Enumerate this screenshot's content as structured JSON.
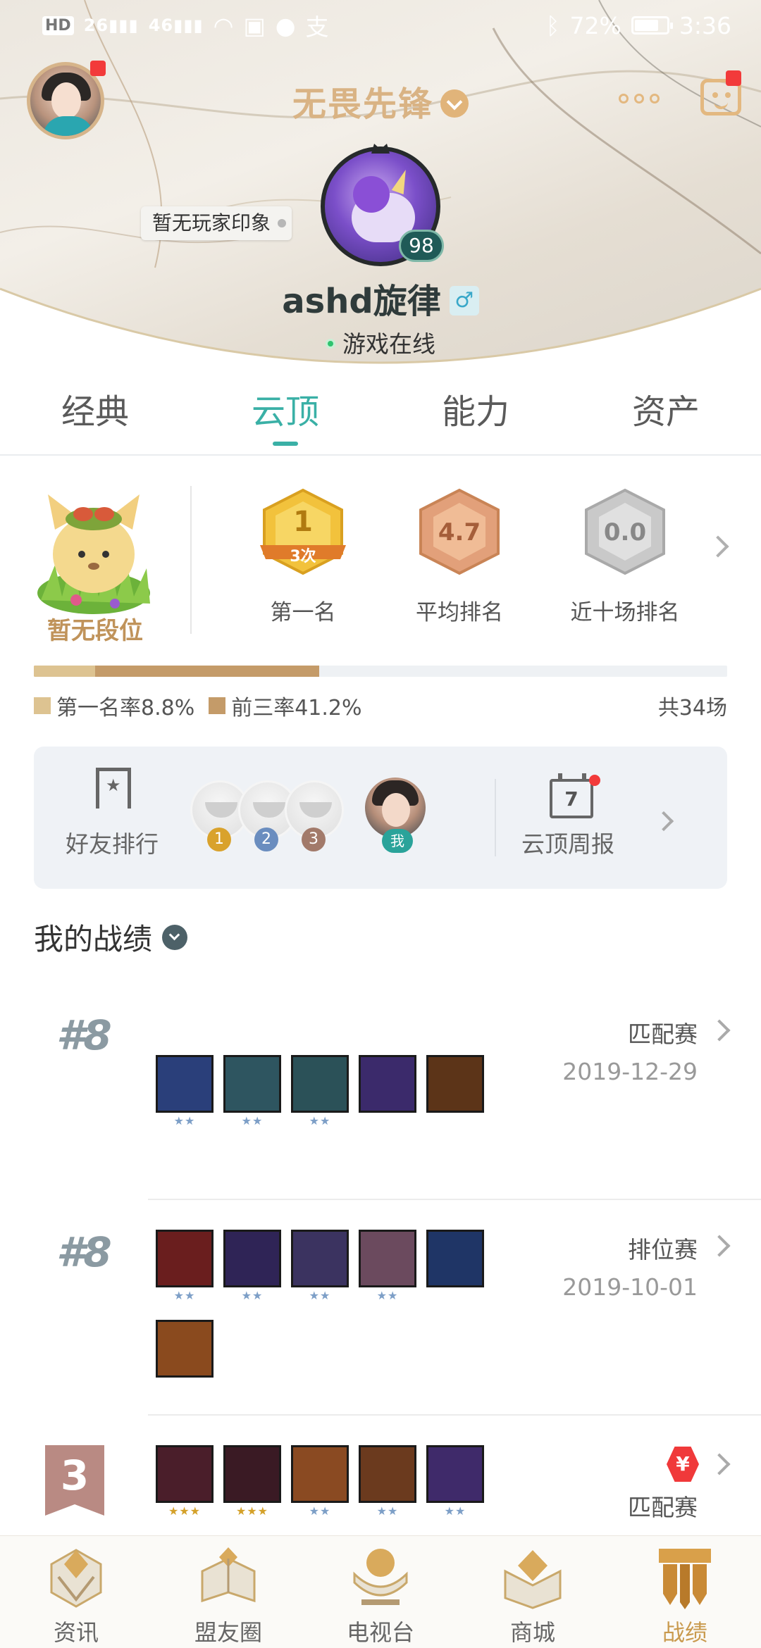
{
  "status_bar": {
    "left_chip": "HD",
    "left_chip_sub": "2",
    "signal_1": "26",
    "signal_2": "46",
    "battery_percent": "72%",
    "time": "3:36"
  },
  "header": {
    "title": "无畏先锋",
    "impression_tag": "暂无玩家印象",
    "level": "98",
    "player_name": "ashd旋律",
    "gender_symbol": "♂",
    "online_status": "游戏在线"
  },
  "tabs": [
    {
      "label": "经典",
      "active": false
    },
    {
      "label": "云顶",
      "active": true
    },
    {
      "label": "能力",
      "active": false
    },
    {
      "label": "资产",
      "active": false
    }
  ],
  "rank": {
    "no_rank_label": "暂无段位",
    "stats": [
      {
        "medal_value": "1",
        "medal_sub": "3次",
        "label": "第一名",
        "color": "#f2c23c"
      },
      {
        "medal_value": "4.7",
        "medal_sub": "",
        "label": "平均排名",
        "color": "#e2a07a"
      },
      {
        "medal_value": "0.0",
        "medal_sub": "",
        "label": "近十场排名",
        "color": "#c9c9c9"
      }
    ],
    "first_rate": 0.088,
    "top3_rate": 0.412,
    "first_rate_label": "第一名率8.8%",
    "top3_rate_label": "前三率41.2%",
    "total_games_label": "共34场"
  },
  "friend_card": {
    "friend_rank_label": "好友排行",
    "rank_numbers": [
      "1",
      "2",
      "3"
    ],
    "me_label": "我",
    "calendar_number": "7",
    "weekly_label": "云顶周报"
  },
  "records": {
    "title": "我的战绩",
    "matches": [
      {
        "placement": "#8",
        "mode": "匹配赛",
        "date": "2019-12-29",
        "champions": [
          {
            "icon": "champion-1",
            "color": "#2a3f7a",
            "stars": "★★",
            "star_color": "blue"
          },
          {
            "icon": "champion-2",
            "color": "#2e5560",
            "stars": "★★",
            "star_color": "blue"
          },
          {
            "icon": "champion-3",
            "color": "#2b5158",
            "stars": "★★",
            "star_color": "blue"
          },
          {
            "icon": "champion-4",
            "color": "#3b2a6b",
            "stars": "",
            "star_color": "blue"
          },
          {
            "icon": "champion-5",
            "color": "#5c3418",
            "stars": "",
            "star_color": "blue"
          }
        ]
      },
      {
        "placement": "#8",
        "mode": "排位赛",
        "date": "2019-10-01",
        "champions": [
          {
            "icon": "champion-6",
            "color": "#6a1e1e",
            "stars": "★★",
            "star_color": "blue"
          },
          {
            "icon": "champion-7",
            "color": "#2f2456",
            "stars": "★★",
            "star_color": "blue"
          },
          {
            "icon": "champion-8",
            "color": "#3b3360",
            "stars": "★★",
            "star_color": "blue"
          },
          {
            "icon": "champion-9",
            "color": "#6b4a5e",
            "stars": "★★",
            "star_color": "blue"
          },
          {
            "icon": "champion-10",
            "color": "#1f3566",
            "stars": "",
            "star_color": "blue"
          },
          {
            "icon": "champion-11",
            "color": "#8a4a1e",
            "stars": "",
            "star_color": "blue"
          }
        ]
      },
      {
        "placement": "3",
        "mode": "匹配赛",
        "currency_badge": "¥",
        "champions": [
          {
            "icon": "champion-12",
            "color": "#4a1e2a",
            "stars": "★★★",
            "star_color": "gold"
          },
          {
            "icon": "champion-13",
            "color": "#3a1a24",
            "stars": "★★★",
            "star_color": "gold"
          },
          {
            "icon": "champion-14",
            "color": "#8a4a22",
            "stars": "★★",
            "star_color": "blue"
          },
          {
            "icon": "champion-15",
            "color": "#6b3a1e",
            "stars": "★★",
            "star_color": "blue"
          },
          {
            "icon": "champion-16",
            "color": "#3f2a6a",
            "stars": "★★",
            "star_color": "blue"
          }
        ]
      }
    ]
  },
  "bottom_nav": [
    {
      "label": "资讯",
      "icon": "news-icon",
      "active": false
    },
    {
      "label": "盟友圈",
      "icon": "friends-circle-icon",
      "active": false
    },
    {
      "label": "电视台",
      "icon": "tv-icon",
      "active": false
    },
    {
      "label": "商城",
      "icon": "shop-icon",
      "active": false
    },
    {
      "label": "战绩",
      "icon": "records-icon",
      "active": true
    }
  ],
  "colors": {
    "accent_teal": "#3ab0a6",
    "gold": "#c99a4e",
    "red_badge": "#f23a3a"
  }
}
